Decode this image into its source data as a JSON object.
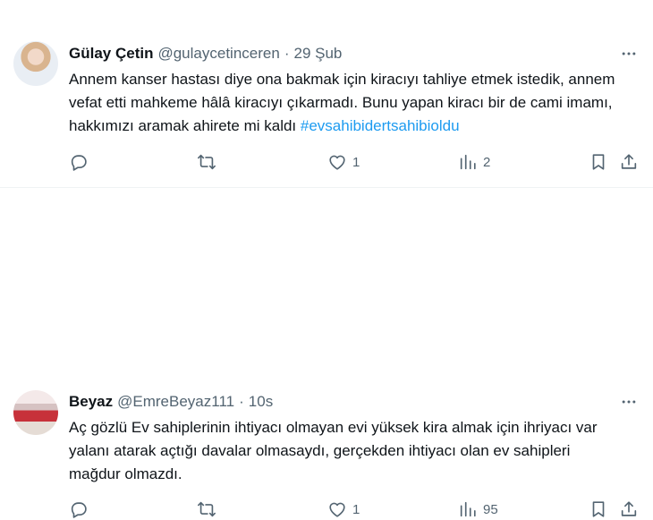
{
  "tweets": [
    {
      "display_name": "Gülay Çetin",
      "handle": "@gulaycetinceren",
      "separator": "·",
      "time": "29 Şub",
      "text": "Annem kanser hastası diye ona bakmak için kiracıyı tahliye etmek istedik, annem vefat etti mahkeme hâlâ kiracıyı çıkarmadı. Bunu yapan kiracı bir de cami imamı, hakkımızı aramak ahirete mi kaldı ",
      "hashtag": "#evsahibidertsahibioldu",
      "replies": "",
      "retweets": "",
      "likes": "1",
      "views": "2"
    },
    {
      "display_name": "Beyaz",
      "handle": "@EmreBeyaz111",
      "separator": "·",
      "time": "10s",
      "text": "Aç gözlü Ev sahiplerinin ihtiyacı olmayan evi yüksek kira almak için ihriyacı var yalanı atarak açtığı davalar olmasaydı, gerçekden ihtiyacı olan ev sahipleri mağdur olmazdı.",
      "replies": "",
      "retweets": "",
      "likes": "1",
      "views": "95"
    }
  ],
  "icons": {
    "reply": "reply-icon",
    "retweet": "retweet-icon",
    "like": "heart-icon",
    "views": "views-icon",
    "bookmark": "bookmark-icon",
    "share": "share-icon",
    "more": "more-icon"
  },
  "colors": {
    "text": "#0f1419",
    "muted": "#536471",
    "link": "#1d9bf0",
    "divider": "#eff3f4"
  }
}
